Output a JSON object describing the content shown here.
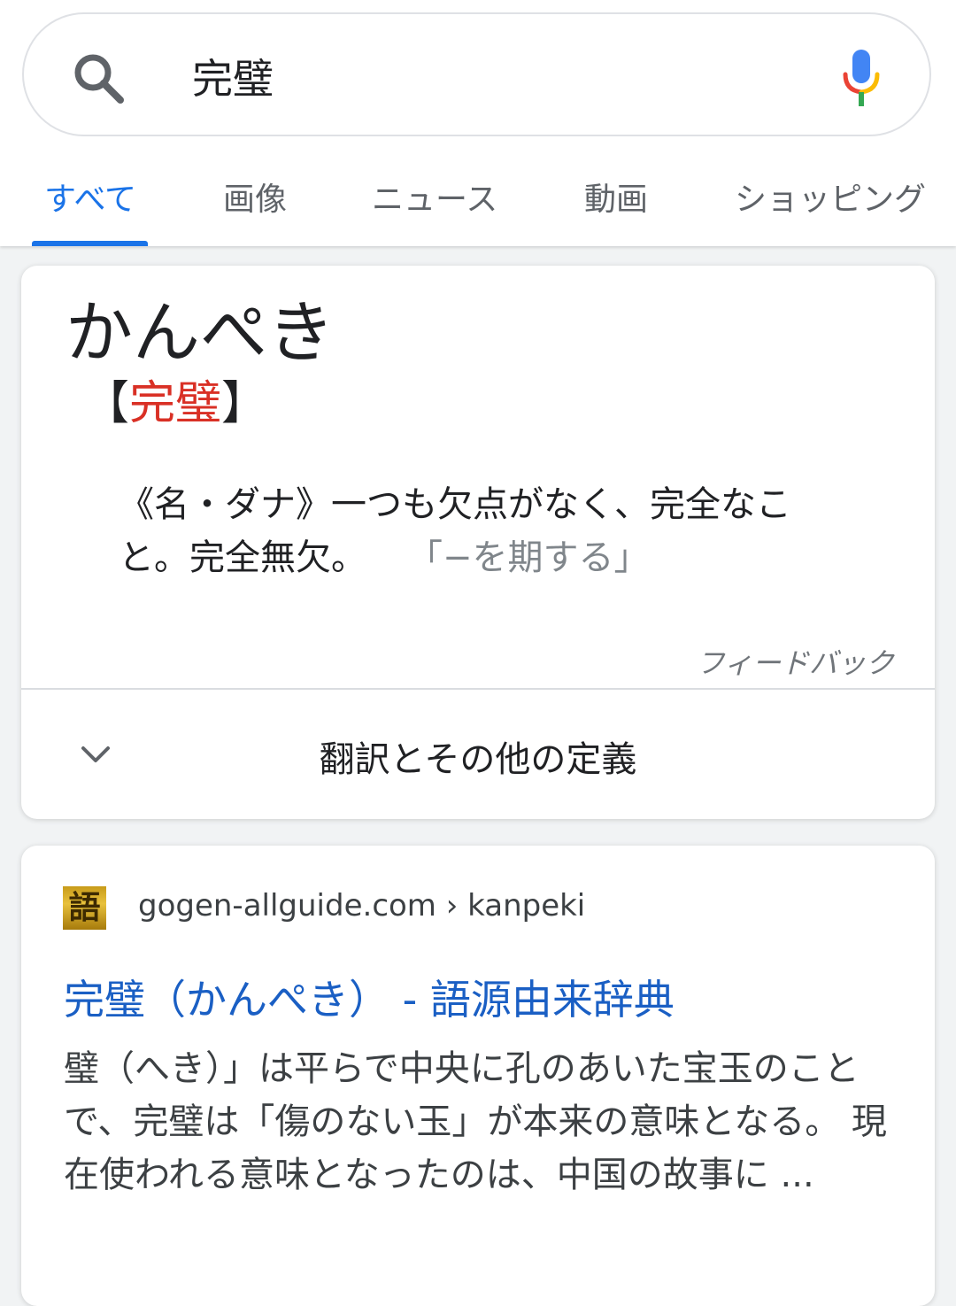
{
  "search": {
    "query": "完璧",
    "mic_colors": [
      "#4285f4",
      "#ea4335",
      "#fbbc05",
      "#34a853"
    ]
  },
  "tabs": [
    {
      "label": "すべて",
      "active": true
    },
    {
      "label": "画像",
      "active": false
    },
    {
      "label": "ニュース",
      "active": false
    },
    {
      "label": "動画",
      "active": false
    },
    {
      "label": "ショッピング",
      "active": false
    }
  ],
  "dictionary": {
    "reading": "かんぺき",
    "bracket_open": "【",
    "kanji": "完璧",
    "bracket_close": "】",
    "definition": "《名・ダナ》一つも欠点がなく、完全なこと。完全無欠。",
    "example": "「−を期する」",
    "feedback": "フィードバック",
    "more_label": "翻訳とその他の定義"
  },
  "result": {
    "favicon_char": "語",
    "url": "gogen-allguide.com › kanpeki",
    "title": "完璧（かんぺき） - 語源由来辞典",
    "snippet": "璧（へき）」は平らで中央に孔のあいた宝玉のことで、完璧は「傷のない玉」が本来の意味となる。 現在使われる意味となったのは、中国の故事に ..."
  },
  "colors": {
    "accent": "#1a73e8",
    "kanji_red": "#d93025",
    "link_blue": "#1a5fc4"
  }
}
